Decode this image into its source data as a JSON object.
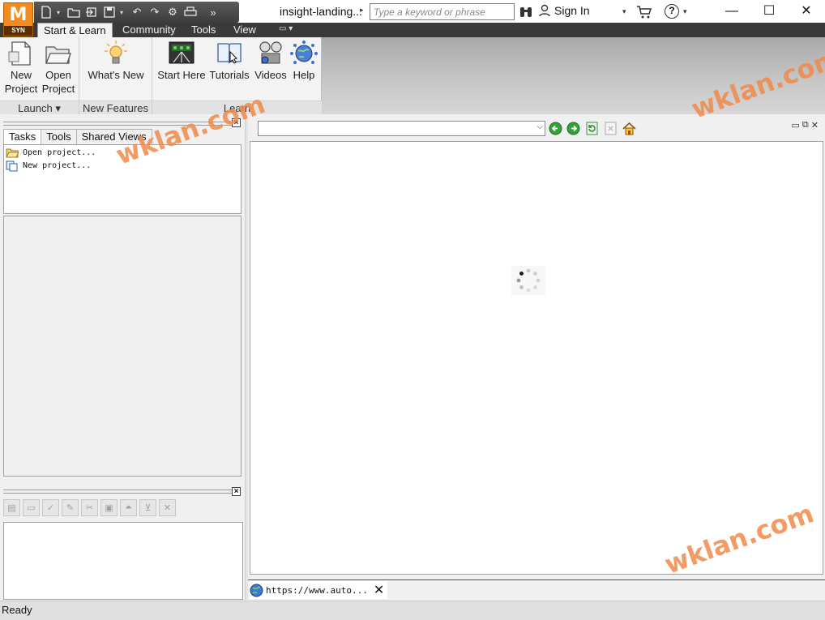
{
  "app": {
    "logo_letter": "M",
    "logo_sub": "SYN",
    "doc_title": "insight-landing...",
    "search_placeholder": "Type a keyword or phrase",
    "sign_in": "Sign In"
  },
  "window_controls": {
    "minimize": "—",
    "maximize": "☐",
    "close": "✕"
  },
  "ribbon": {
    "tabs": [
      "Start & Learn",
      "Community",
      "Tools",
      "View"
    ],
    "groups": {
      "launch": {
        "label": "Launch ▾",
        "new_project": "New Project",
        "open_project": "Open Project"
      },
      "new_features": {
        "label": "New Features",
        "whats_new": "What's New"
      },
      "learn": {
        "label": "Learn",
        "start_here": "Start Here",
        "tutorials": "Tutorials",
        "videos": "Videos",
        "help": "Help"
      }
    }
  },
  "left_panel": {
    "tabs": [
      "Tasks",
      "Tools",
      "Shared Views"
    ],
    "tasks": [
      "Open project...",
      "New project..."
    ]
  },
  "browser": {
    "url_value": "",
    "tab_label": "https://www.auto..."
  },
  "status": {
    "text": "Ready"
  },
  "watermark": "wklan.com",
  "colors": {
    "accent": "#f28c1e",
    "tabbar": "#3a3a3a",
    "watermark": "#f08a4a"
  }
}
